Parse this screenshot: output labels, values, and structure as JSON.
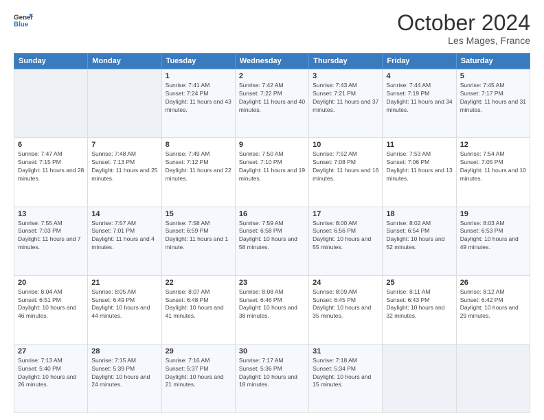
{
  "header": {
    "logo_line1": "General",
    "logo_line2": "Blue",
    "month": "October 2024",
    "location": "Les Mages, France"
  },
  "weekdays": [
    "Sunday",
    "Monday",
    "Tuesday",
    "Wednesday",
    "Thursday",
    "Friday",
    "Saturday"
  ],
  "weeks": [
    [
      {
        "day": "",
        "empty": true
      },
      {
        "day": "",
        "empty": true
      },
      {
        "day": "1",
        "sunrise": "Sunrise: 7:41 AM",
        "sunset": "Sunset: 7:24 PM",
        "daylight": "Daylight: 11 hours and 43 minutes."
      },
      {
        "day": "2",
        "sunrise": "Sunrise: 7:42 AM",
        "sunset": "Sunset: 7:22 PM",
        "daylight": "Daylight: 11 hours and 40 minutes."
      },
      {
        "day": "3",
        "sunrise": "Sunrise: 7:43 AM",
        "sunset": "Sunset: 7:21 PM",
        "daylight": "Daylight: 11 hours and 37 minutes."
      },
      {
        "day": "4",
        "sunrise": "Sunrise: 7:44 AM",
        "sunset": "Sunset: 7:19 PM",
        "daylight": "Daylight: 11 hours and 34 minutes."
      },
      {
        "day": "5",
        "sunrise": "Sunrise: 7:45 AM",
        "sunset": "Sunset: 7:17 PM",
        "daylight": "Daylight: 11 hours and 31 minutes."
      }
    ],
    [
      {
        "day": "6",
        "sunrise": "Sunrise: 7:47 AM",
        "sunset": "Sunset: 7:15 PM",
        "daylight": "Daylight: 11 hours and 28 minutes."
      },
      {
        "day": "7",
        "sunrise": "Sunrise: 7:48 AM",
        "sunset": "Sunset: 7:13 PM",
        "daylight": "Daylight: 11 hours and 25 minutes."
      },
      {
        "day": "8",
        "sunrise": "Sunrise: 7:49 AM",
        "sunset": "Sunset: 7:12 PM",
        "daylight": "Daylight: 11 hours and 22 minutes."
      },
      {
        "day": "9",
        "sunrise": "Sunrise: 7:50 AM",
        "sunset": "Sunset: 7:10 PM",
        "daylight": "Daylight: 11 hours and 19 minutes."
      },
      {
        "day": "10",
        "sunrise": "Sunrise: 7:52 AM",
        "sunset": "Sunset: 7:08 PM",
        "daylight": "Daylight: 11 hours and 16 minutes."
      },
      {
        "day": "11",
        "sunrise": "Sunrise: 7:53 AM",
        "sunset": "Sunset: 7:06 PM",
        "daylight": "Daylight: 11 hours and 13 minutes."
      },
      {
        "day": "12",
        "sunrise": "Sunrise: 7:54 AM",
        "sunset": "Sunset: 7:05 PM",
        "daylight": "Daylight: 11 hours and 10 minutes."
      }
    ],
    [
      {
        "day": "13",
        "sunrise": "Sunrise: 7:55 AM",
        "sunset": "Sunset: 7:03 PM",
        "daylight": "Daylight: 11 hours and 7 minutes."
      },
      {
        "day": "14",
        "sunrise": "Sunrise: 7:57 AM",
        "sunset": "Sunset: 7:01 PM",
        "daylight": "Daylight: 11 hours and 4 minutes."
      },
      {
        "day": "15",
        "sunrise": "Sunrise: 7:58 AM",
        "sunset": "Sunset: 6:59 PM",
        "daylight": "Daylight: 11 hours and 1 minute."
      },
      {
        "day": "16",
        "sunrise": "Sunrise: 7:59 AM",
        "sunset": "Sunset: 6:58 PM",
        "daylight": "Daylight: 10 hours and 58 minutes."
      },
      {
        "day": "17",
        "sunrise": "Sunrise: 8:00 AM",
        "sunset": "Sunset: 6:56 PM",
        "daylight": "Daylight: 10 hours and 55 minutes."
      },
      {
        "day": "18",
        "sunrise": "Sunrise: 8:02 AM",
        "sunset": "Sunset: 6:54 PM",
        "daylight": "Daylight: 10 hours and 52 minutes."
      },
      {
        "day": "19",
        "sunrise": "Sunrise: 8:03 AM",
        "sunset": "Sunset: 6:53 PM",
        "daylight": "Daylight: 10 hours and 49 minutes."
      }
    ],
    [
      {
        "day": "20",
        "sunrise": "Sunrise: 8:04 AM",
        "sunset": "Sunset: 6:51 PM",
        "daylight": "Daylight: 10 hours and 46 minutes."
      },
      {
        "day": "21",
        "sunrise": "Sunrise: 8:05 AM",
        "sunset": "Sunset: 6:49 PM",
        "daylight": "Daylight: 10 hours and 44 minutes."
      },
      {
        "day": "22",
        "sunrise": "Sunrise: 8:07 AM",
        "sunset": "Sunset: 6:48 PM",
        "daylight": "Daylight: 10 hours and 41 minutes."
      },
      {
        "day": "23",
        "sunrise": "Sunrise: 8:08 AM",
        "sunset": "Sunset: 6:46 PM",
        "daylight": "Daylight: 10 hours and 38 minutes."
      },
      {
        "day": "24",
        "sunrise": "Sunrise: 8:09 AM",
        "sunset": "Sunset: 6:45 PM",
        "daylight": "Daylight: 10 hours and 35 minutes."
      },
      {
        "day": "25",
        "sunrise": "Sunrise: 8:11 AM",
        "sunset": "Sunset: 6:43 PM",
        "daylight": "Daylight: 10 hours and 32 minutes."
      },
      {
        "day": "26",
        "sunrise": "Sunrise: 8:12 AM",
        "sunset": "Sunset: 6:42 PM",
        "daylight": "Daylight: 10 hours and 29 minutes."
      }
    ],
    [
      {
        "day": "27",
        "sunrise": "Sunrise: 7:13 AM",
        "sunset": "Sunset: 5:40 PM",
        "daylight": "Daylight: 10 hours and 26 minutes."
      },
      {
        "day": "28",
        "sunrise": "Sunrise: 7:15 AM",
        "sunset": "Sunset: 5:39 PM",
        "daylight": "Daylight: 10 hours and 24 minutes."
      },
      {
        "day": "29",
        "sunrise": "Sunrise: 7:16 AM",
        "sunset": "Sunset: 5:37 PM",
        "daylight": "Daylight: 10 hours and 21 minutes."
      },
      {
        "day": "30",
        "sunrise": "Sunrise: 7:17 AM",
        "sunset": "Sunset: 5:36 PM",
        "daylight": "Daylight: 10 hours and 18 minutes."
      },
      {
        "day": "31",
        "sunrise": "Sunrise: 7:18 AM",
        "sunset": "Sunset: 5:34 PM",
        "daylight": "Daylight: 10 hours and 15 minutes."
      },
      {
        "day": "",
        "empty": true
      },
      {
        "day": "",
        "empty": true
      }
    ]
  ]
}
